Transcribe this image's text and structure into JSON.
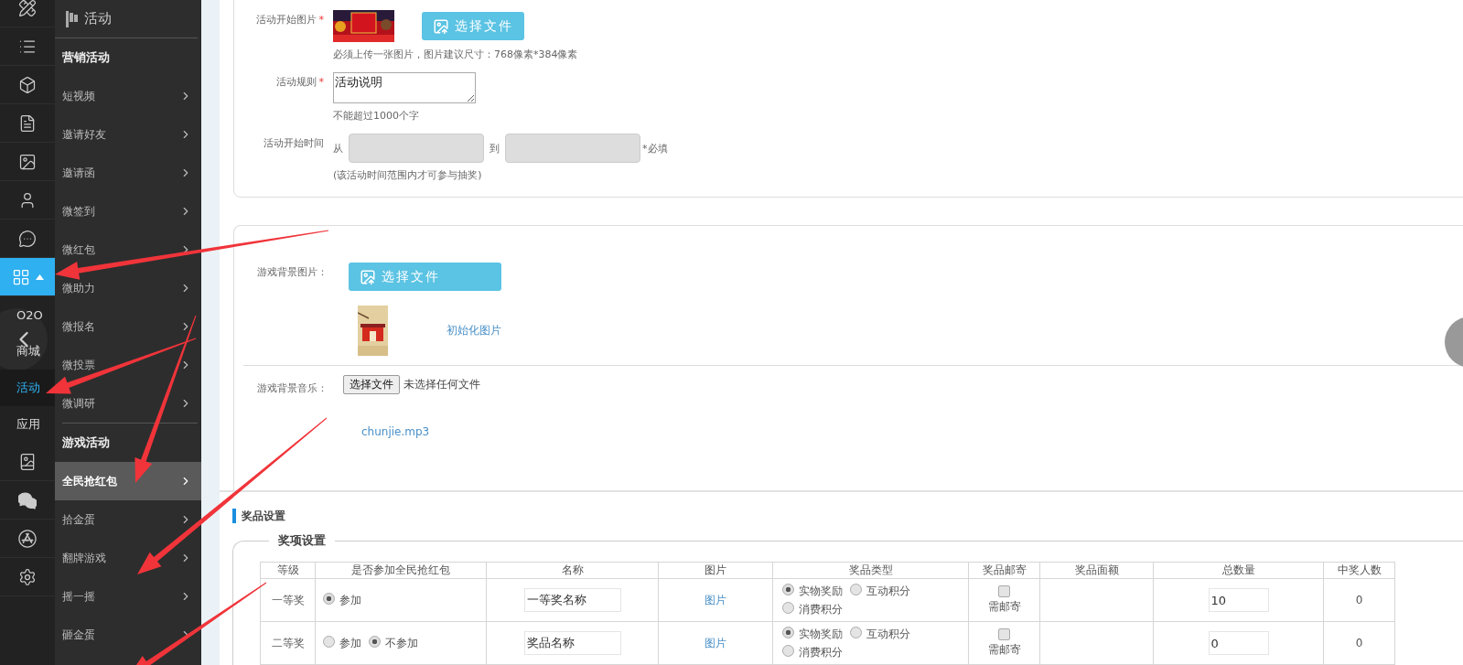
{
  "icon_rail": {
    "items": [
      {
        "kind": "icon",
        "selected": false,
        "expanded": false
      },
      {
        "kind": "icon",
        "selected": false,
        "expanded": false
      },
      {
        "kind": "icon",
        "selected": false,
        "expanded": false
      },
      {
        "kind": "icon",
        "selected": false,
        "expanded": false
      },
      {
        "kind": "icon",
        "selected": false,
        "expanded": false
      },
      {
        "kind": "icon",
        "selected": false,
        "expanded": false
      },
      {
        "kind": "icon",
        "selected": false,
        "expanded": false
      },
      {
        "kind": "icon",
        "selected": true,
        "expanded": true
      },
      {
        "kind": "sub",
        "label": "O2O",
        "selected": false
      },
      {
        "kind": "sub",
        "label": "商城",
        "selected": false
      },
      {
        "kind": "sub",
        "label": "活动",
        "selected": true
      },
      {
        "kind": "sub",
        "label": "应用",
        "selected": false
      },
      {
        "kind": "icon",
        "selected": false,
        "expanded": false
      },
      {
        "kind": "icon",
        "selected": false,
        "expanded": false
      },
      {
        "kind": "icon",
        "selected": false,
        "expanded": false
      },
      {
        "kind": "icon",
        "selected": false,
        "expanded": false
      }
    ]
  },
  "sidebar": {
    "title": "活动",
    "groups": [
      {
        "title": "营销活动",
        "items": [
          {
            "label": "短视频",
            "selected": false
          },
          {
            "label": "邀请好友",
            "selected": false
          },
          {
            "label": "邀请函",
            "selected": false
          },
          {
            "label": "微签到",
            "selected": false
          },
          {
            "label": "微红包",
            "selected": false
          },
          {
            "label": "微助力",
            "selected": false
          },
          {
            "label": "微报名",
            "selected": false
          },
          {
            "label": "微投票",
            "selected": false
          },
          {
            "label": "微调研",
            "selected": false
          }
        ]
      },
      {
        "title": "游戏活动",
        "items": [
          {
            "label": "全民抢红包",
            "selected": true
          },
          {
            "label": "拾金蛋",
            "selected": false
          },
          {
            "label": "翻牌游戏",
            "selected": false
          },
          {
            "label": "摇一摇",
            "selected": false
          },
          {
            "label": "砸金蛋",
            "selected": false
          }
        ]
      }
    ]
  },
  "activity_form": {
    "rows": [
      {
        "kind": "image_upload",
        "label": "活动开始图片",
        "required_mark": "*",
        "button": "选择文件",
        "hint": "必须上传一张图片，图片建议尺寸：768像素*384像素"
      },
      {
        "kind": "textarea",
        "label": "活动规则",
        "required_mark": "*",
        "value": "活动说明",
        "hint": "不能超过1000个字"
      },
      {
        "kind": "date_range",
        "label": "活动开始时间",
        "from": "从",
        "to": "到",
        "note": "*必填",
        "hint": "(该活动时间范围内才可参与抽奖)"
      }
    ]
  },
  "game_settings": {
    "background_image": {
      "label": "游戏背景图片：",
      "button": "选择文件",
      "link": "初始化图片"
    },
    "background_music": {
      "label": "游戏背景音乐：",
      "button": "选择文件",
      "status": "未选择任何文件",
      "file": "chunjie.mp3"
    }
  },
  "prizes": {
    "title": "奖品设置",
    "legend": "奖项设置",
    "table": {
      "columns": [
        "等级",
        "是否参加全民抢红包",
        "名称",
        "图片",
        "奖品类型",
        "奖品邮寄",
        "奖品面额",
        "总数量",
        "中奖人数"
      ],
      "rows": [
        {
          "level": "一等奖",
          "join": [
            {
              "label": "参加",
              "selected": true
            }
          ],
          "name": "一等奖名称",
          "image": "图片",
          "types": [
            {
              "label": "实物奖励",
              "selected": true
            },
            {
              "label": "互动积分",
              "selected": false
            },
            {
              "label": "消费积分",
              "selected": false
            }
          ],
          "mail": {
            "label": "需邮寄",
            "checked": false
          },
          "total": "10",
          "winners": "0"
        },
        {
          "level": "二等奖",
          "join": [
            {
              "label": "参加",
              "selected": false
            },
            {
              "label": "不参加",
              "selected": true
            }
          ],
          "name": "奖品名称",
          "image": "图片",
          "types": [
            {
              "label": "实物奖励",
              "selected": true
            },
            {
              "label": "互动积分",
              "selected": false
            },
            {
              "label": "消费积分",
              "selected": false
            }
          ],
          "mail": {
            "label": "需邮寄",
            "checked": false
          },
          "total": "0",
          "winners": "0"
        }
      ]
    }
  }
}
